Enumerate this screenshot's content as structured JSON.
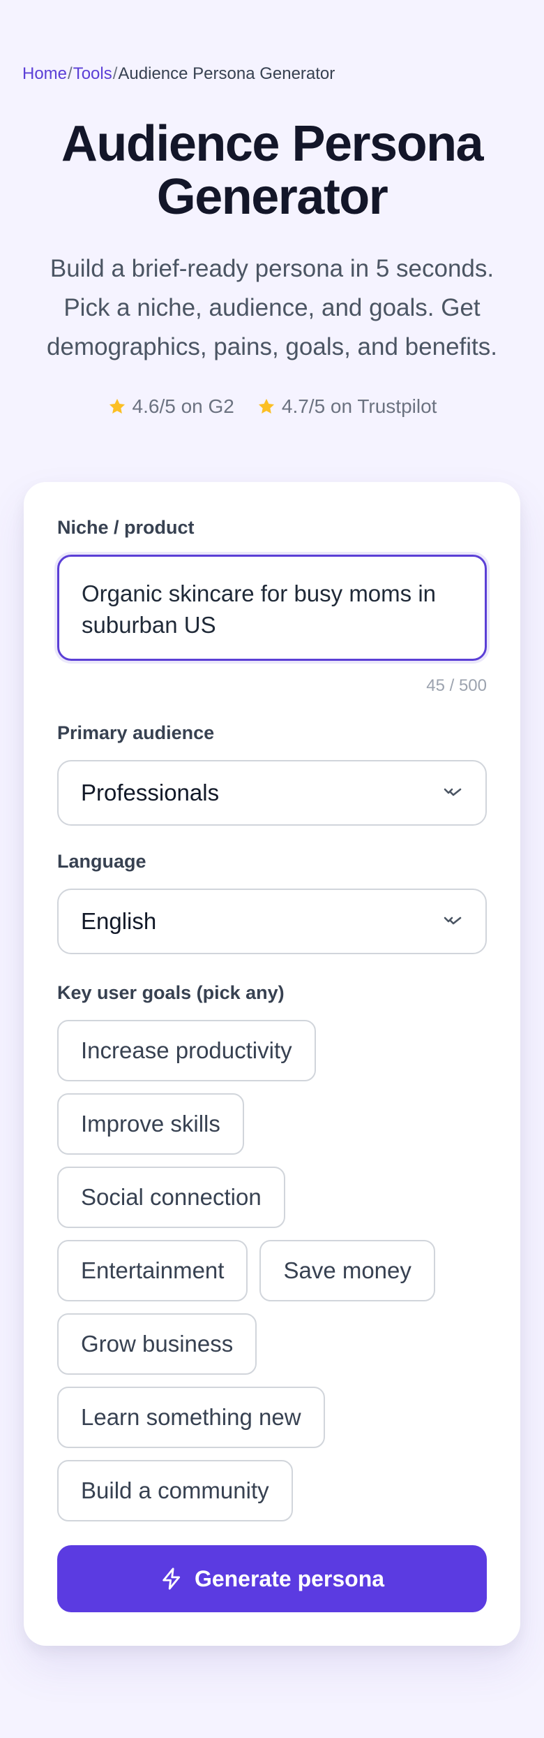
{
  "breadcrumb": {
    "home": "Home",
    "tools": "Tools",
    "current": "Audience Persona Generator",
    "separator": "/"
  },
  "header": {
    "title_line1": "Audience Persona",
    "title_line2": "Generator",
    "subtitle_line1": "Build a brief-ready persona in 5 seconds.",
    "subtitle_line2": "Pick a niche, audience, and goals. Get",
    "subtitle_line3": "demographics, pains, goals, and benefits."
  },
  "ratings": [
    {
      "icon": "star-icon",
      "text": "4.6/5 on G2"
    },
    {
      "icon": "star-icon",
      "text": "4.7/5 on Trustpilot"
    }
  ],
  "form": {
    "niche": {
      "label": "Niche / product",
      "value_line1": "Organic skincare for busy moms in",
      "value_line2": "suburban US",
      "counter": "45 / 500"
    },
    "audience": {
      "label": "Primary audience",
      "selected": "Professionals"
    },
    "language": {
      "label": "Language",
      "selected": "English"
    },
    "goals": {
      "label": "Key user goals (pick any)",
      "options": [
        "Increase productivity",
        "Improve skills",
        "Social connection",
        "Entertainment",
        "Save money",
        "Grow business",
        "Learn something new",
        "Build a community"
      ]
    },
    "submit_label": "Generate persona"
  },
  "colors": {
    "accent": "#5b3be1",
    "star": "#fbbf24",
    "background": "#f5f3ff"
  }
}
